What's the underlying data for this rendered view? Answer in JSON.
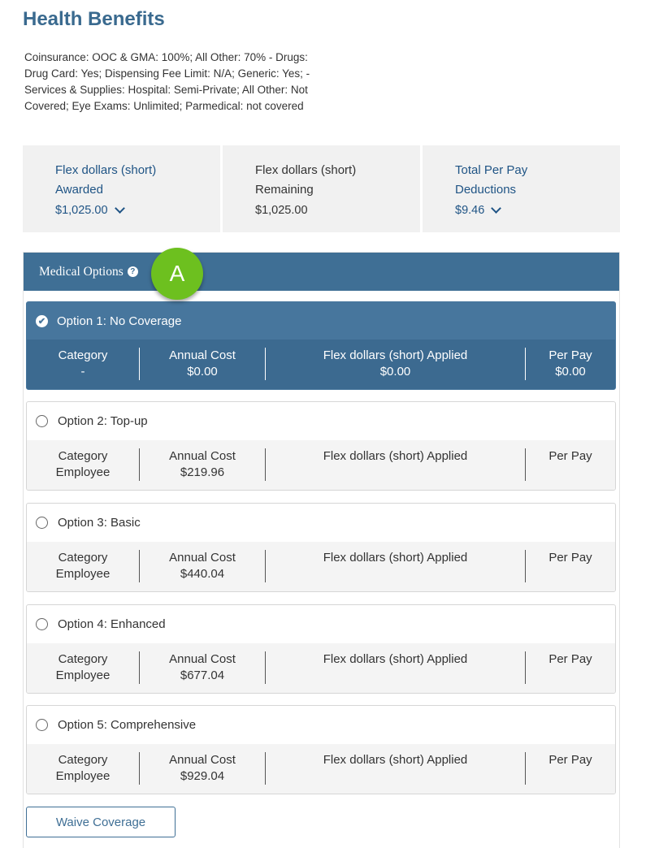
{
  "page": {
    "title": "Health Benefits",
    "description": "Coinsurance: OOC & GMA: 100%; All Other: 70% - Drugs: Drug Card: Yes; Dispensing Fee Limit: N/A; Generic: Yes; -Services & Supplies: Hospital: Semi-Private; All Other: Not Covered; Eye Exams: Unlimited; Parmedical: not covered"
  },
  "summary": {
    "awarded": {
      "line1": "Flex dollars (short)",
      "line2": "Awarded",
      "amount": "$1,025.00"
    },
    "remaining": {
      "line1": "Flex dollars (short)",
      "line2": "Remaining",
      "amount": "$1,025.00"
    },
    "deductions": {
      "line1": "Total Per Pay",
      "line2": "Deductions",
      "amount": "$9.46"
    }
  },
  "medical": {
    "header": "Medical Options",
    "help_icon": "?",
    "badge": "A",
    "col_headers": {
      "category": "Category",
      "annual_cost": "Annual Cost",
      "flex_applied": "Flex dollars (short) Applied",
      "per_pay": "Per Pay"
    },
    "options": [
      {
        "label": "Option 1: No Coverage",
        "selected": true,
        "category": "-",
        "annual_cost": "$0.00",
        "flex_applied": "$0.00",
        "per_pay": "$0.00"
      },
      {
        "label": "Option 2: Top-up",
        "selected": false,
        "category": "Employee",
        "annual_cost": "$219.96",
        "flex_applied": "",
        "per_pay": ""
      },
      {
        "label": "Option 3: Basic",
        "selected": false,
        "category": "Employee",
        "annual_cost": "$440.04",
        "flex_applied": "",
        "per_pay": ""
      },
      {
        "label": "Option 4: Enhanced",
        "selected": false,
        "category": "Employee",
        "annual_cost": "$677.04",
        "flex_applied": "",
        "per_pay": ""
      },
      {
        "label": "Option 5: Comprehensive",
        "selected": false,
        "category": "Employee",
        "annual_cost": "$929.04",
        "flex_applied": "",
        "per_pay": ""
      }
    ],
    "waive_label": "Waive Coverage"
  },
  "colors": {
    "header_bg": "#3f6f95",
    "selected_bg": "#47769d",
    "badge": "#6dc01f",
    "title": "#3a6a8f",
    "link": "#1f5485"
  }
}
